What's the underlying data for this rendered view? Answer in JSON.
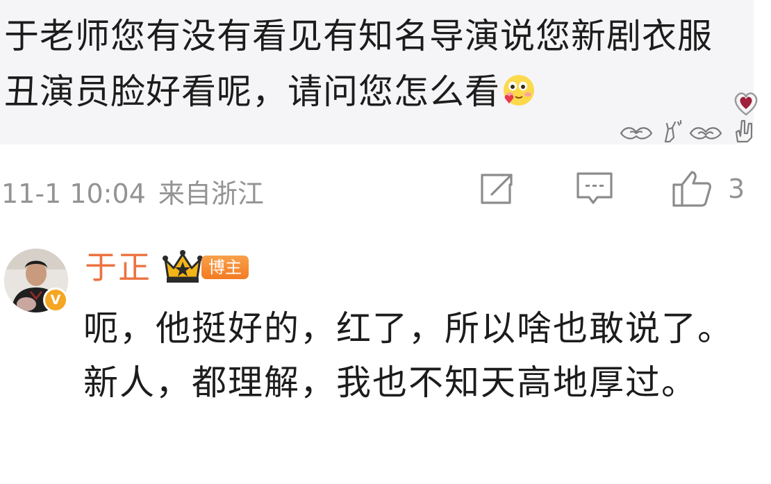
{
  "quoted_comment": {
    "text": "于老师您有没有看见有知名导演说您新剧衣服丑演员脸好看呢，请问您怎么看",
    "emoji": "blushing-face-with-heart-emoji",
    "stickers": [
      "heart-sticker",
      "heart-hands-sticker",
      "finger-heart-sticker",
      "heart-hands-sticker",
      "rock-hand-sticker"
    ]
  },
  "meta": {
    "time": "11-1 10:04",
    "location": "来自浙江",
    "like_count": "3",
    "icons": [
      "share-icon",
      "comment-icon",
      "like-icon"
    ]
  },
  "reply": {
    "author": "于正",
    "badge": "博主",
    "verified_mark": "V",
    "text": "呃，他挺好的，红了，所以啥也敢说了。新人，都理解，我也不知天高地厚过。"
  },
  "colors": {
    "bubble_bg": "#f5f5f7",
    "text": "#1c1c1c",
    "meta_gray": "#939393",
    "author_orange": "#eb7340",
    "badge_orange": "#f27b23"
  }
}
